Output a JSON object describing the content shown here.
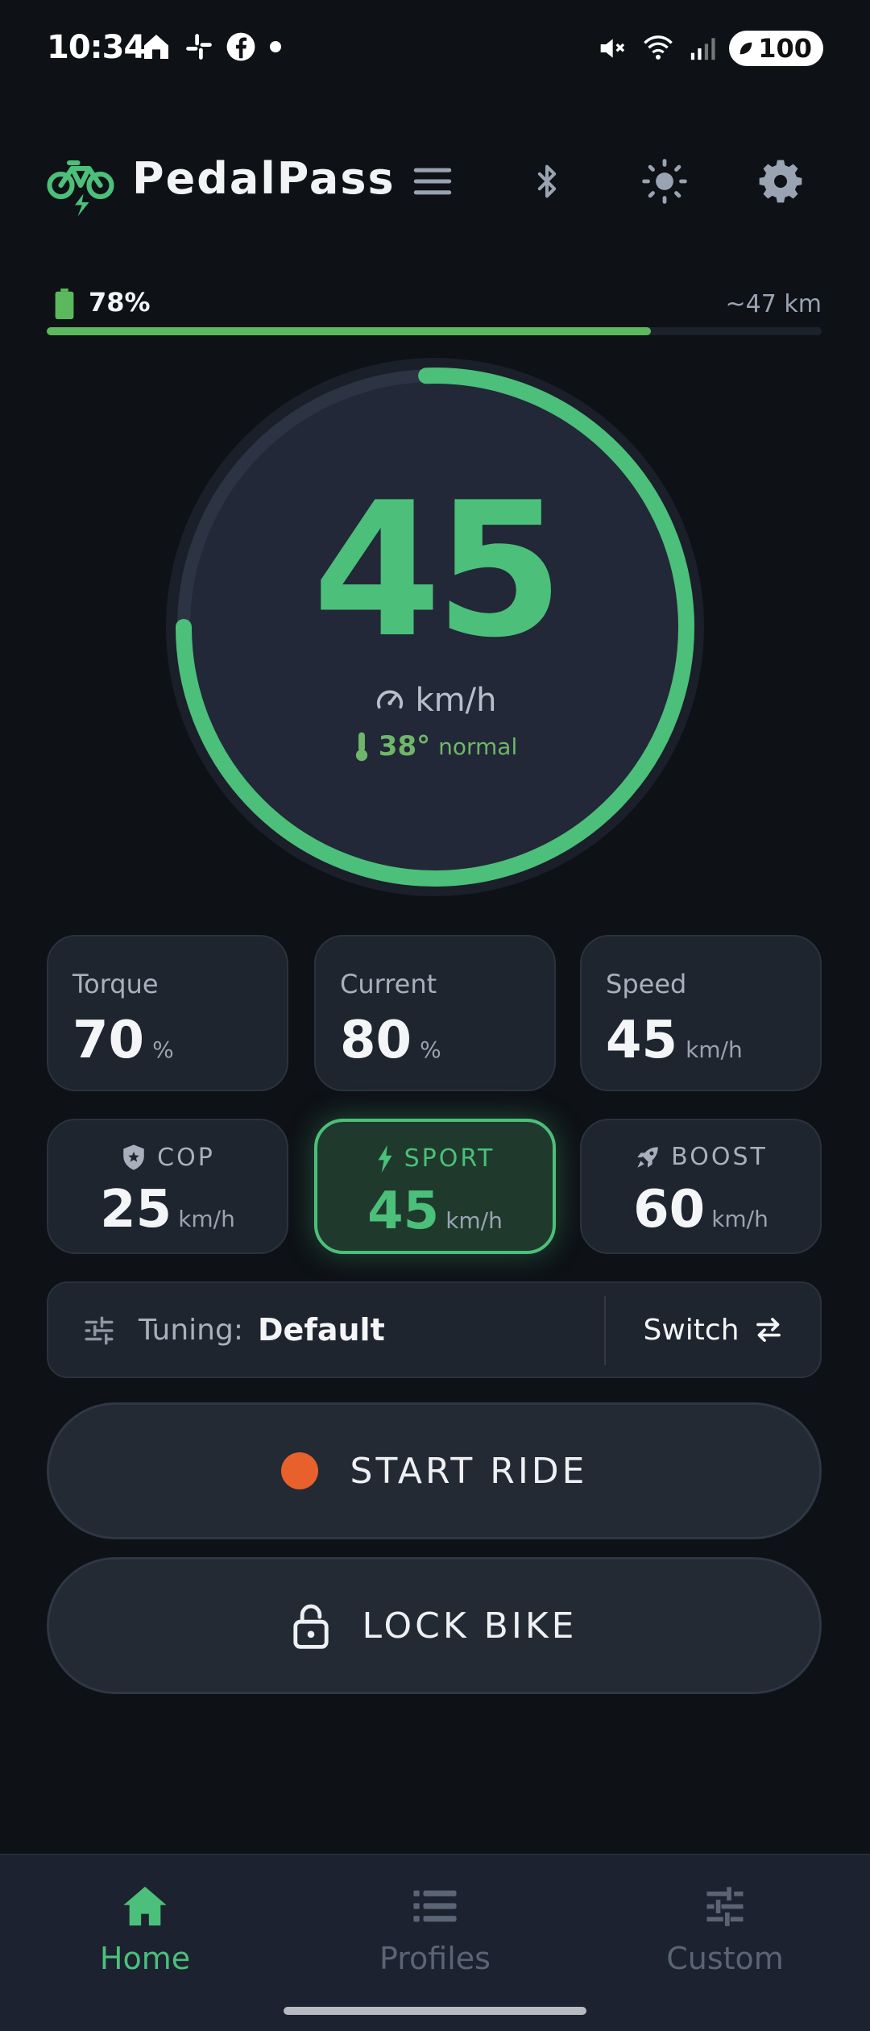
{
  "status_bar": {
    "time": "10:34",
    "battery": "100"
  },
  "header": {
    "app_name": "PedalPass"
  },
  "battery": {
    "percent_label": "78%",
    "percent": 78,
    "range": "~47 km"
  },
  "gauge": {
    "speed": "45",
    "unit": "km/h",
    "temperature": "38°",
    "temperature_status": "normal"
  },
  "stats": [
    {
      "label": "Torque",
      "value": "70",
      "unit": "%"
    },
    {
      "label": "Current",
      "value": "80",
      "unit": "%"
    },
    {
      "label": "Speed",
      "value": "45",
      "unit": "km/h"
    }
  ],
  "modes": [
    {
      "name": "COP",
      "value": "25",
      "unit": "km/h",
      "active": false
    },
    {
      "name": "SPORT",
      "value": "45",
      "unit": "km/h",
      "active": true
    },
    {
      "name": "BOOST",
      "value": "60",
      "unit": "km/h",
      "active": false
    }
  ],
  "tuning": {
    "label": "Tuning:",
    "value": "Default",
    "switch_label": "Switch"
  },
  "actions": {
    "start_ride": "START RIDE",
    "lock_bike": "LOCK BIKE"
  },
  "nav": {
    "home": "Home",
    "profiles": "Profiles",
    "custom": "Custom"
  },
  "colors": {
    "accent": "#4cbf7a",
    "record": "#e8612c",
    "background": "#0e1116"
  }
}
